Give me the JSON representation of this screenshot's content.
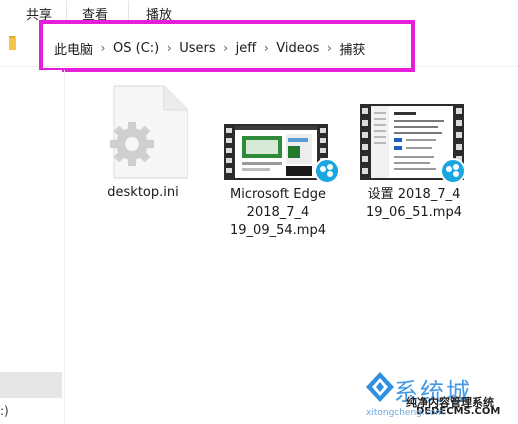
{
  "ribbon": {
    "tabs": [
      "共享",
      "查看",
      "播放"
    ]
  },
  "address": {
    "crumbs": [
      "此电脑",
      "OS (C:)",
      "Users",
      "jeff",
      "Videos",
      "捕获"
    ]
  },
  "nav": {
    "drive_label": ":)"
  },
  "files": [
    {
      "name": "desktop.ini",
      "type": "settings-file"
    },
    {
      "name_lines": [
        "Microsoft Edge",
        "2018_7_4",
        "19_09_54.mp4"
      ],
      "type": "video"
    },
    {
      "name_lines": [
        "设置 2018_7_4",
        "19_06_51.mp4"
      ],
      "type": "video"
    }
  ],
  "watermark": {
    "title": "系统城",
    "subtitle": "纯净内容管理系统",
    "url": "DEDECMS.COM",
    "domain": "xitongcheng.com"
  },
  "colors": {
    "highlight": "#e51ed9",
    "folder": "#f4c34a",
    "player_badge": "#1aa6e0"
  }
}
